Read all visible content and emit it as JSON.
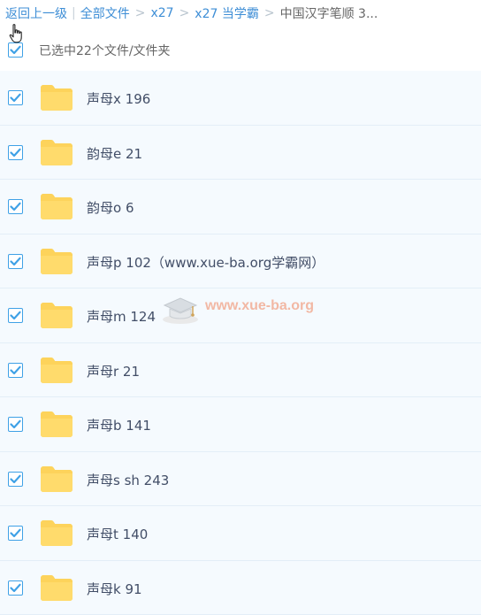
{
  "breadcrumb": {
    "back": "返回上一级",
    "all_files": "全部文件",
    "crumb1": "x27",
    "crumb2": "x27 当学霸",
    "current": "中国汉字笔顺 3..."
  },
  "select_all": {
    "label": "已选中22个文件/文件夹",
    "checked": true
  },
  "files": [
    {
      "name": "声母x 196",
      "checked": true
    },
    {
      "name": "韵母e 21",
      "checked": true
    },
    {
      "name": "韵母o 6",
      "checked": true
    },
    {
      "name": "声母p 102（www.xue-ba.org学霸网）",
      "checked": true
    },
    {
      "name": "声母m 124",
      "checked": true
    },
    {
      "name": "声母r 21",
      "checked": true
    },
    {
      "name": "声母b 141",
      "checked": true
    },
    {
      "name": "声母s sh 243",
      "checked": true
    },
    {
      "name": "声母t 140",
      "checked": true
    },
    {
      "name": "声母k 91",
      "checked": true
    }
  ],
  "watermark": {
    "text": "www.xue-ba.org"
  },
  "colors": {
    "link": "#3e8ed6",
    "checkbox": "#3fa1e6",
    "folder": "#fdd35b",
    "row_bg": "#f5fafe"
  },
  "icons": {
    "folder": "folder-icon",
    "check": "checkmark-icon",
    "cursor": "hand-cursor-icon"
  }
}
